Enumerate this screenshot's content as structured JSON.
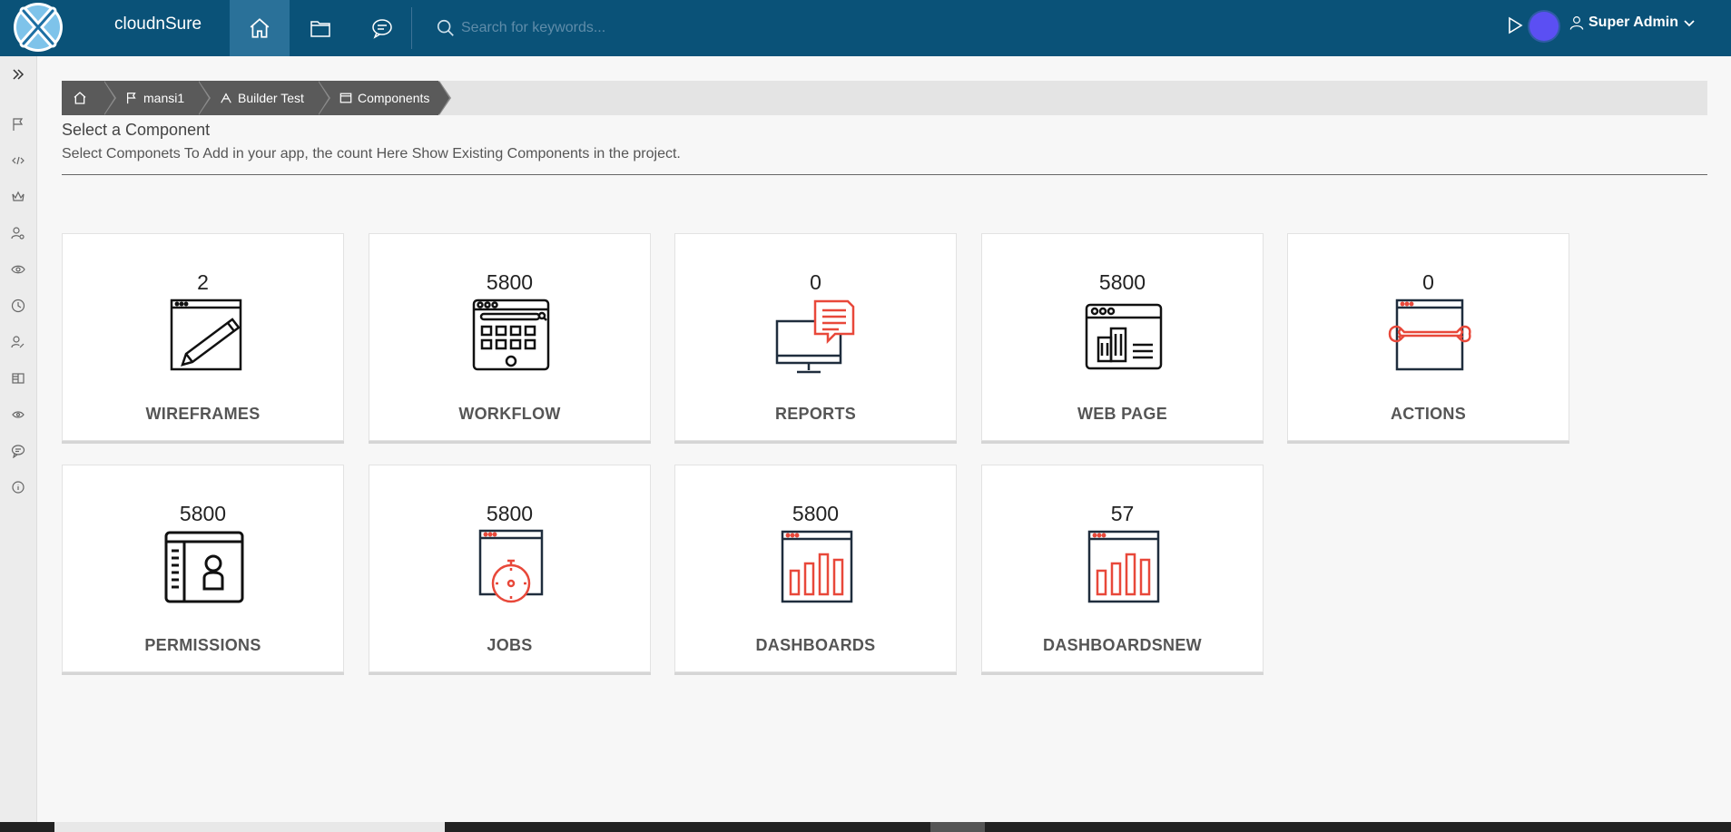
{
  "app": {
    "title": "cloudnSure"
  },
  "search": {
    "placeholder": "Search for keywords..."
  },
  "user": {
    "name": "Super Admin"
  },
  "breadcrumb": [
    {
      "label": "",
      "icon": "home-icon"
    },
    {
      "label": "mansi1",
      "icon": "flag-icon"
    },
    {
      "label": "Builder Test",
      "icon": "builder-icon"
    },
    {
      "label": "Components",
      "icon": "window-icon"
    }
  ],
  "page": {
    "title": "Select a Component",
    "subtitle": "Select Componets To Add in your app, the count Here Show Existing Components in the project."
  },
  "components": [
    {
      "label": "WIREFRAMES",
      "count": "2",
      "icon": "wireframe-icon"
    },
    {
      "label": "WORKFLOW",
      "count": "5800",
      "icon": "workflow-icon"
    },
    {
      "label": "REPORTS",
      "count": "0",
      "icon": "reports-icon"
    },
    {
      "label": "WEB PAGE",
      "count": "5800",
      "icon": "web-page-icon"
    },
    {
      "label": "ACTIONS",
      "count": "0",
      "icon": "actions-icon"
    },
    {
      "label": "PERMISSIONS",
      "count": "5800",
      "icon": "permissions-icon"
    },
    {
      "label": "JOBS",
      "count": "5800",
      "icon": "jobs-icon"
    },
    {
      "label": "DASHBOARDS",
      "count": "5800",
      "icon": "dashboards-icon"
    },
    {
      "label": "DASHBOARDSNEW",
      "count": "57",
      "icon": "dashboardsnew-icon"
    }
  ],
  "colors": {
    "topbar": "#0a5278",
    "accent": "#e8483a",
    "icon_dark": "#1f2d3d",
    "avatar": "#5b4ff3"
  }
}
